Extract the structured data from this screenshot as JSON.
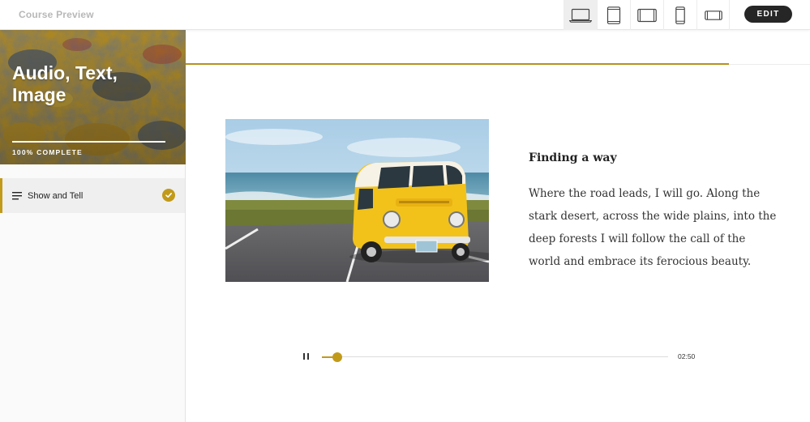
{
  "app": {
    "title": "Course Preview"
  },
  "toolbar": {
    "devices": [
      {
        "icon": "laptop-icon",
        "active": true
      },
      {
        "icon": "tablet-portrait-icon",
        "active": false
      },
      {
        "icon": "tablet-landscape-icon",
        "active": false
      },
      {
        "icon": "phone-portrait-icon",
        "active": false
      },
      {
        "icon": "phone-landscape-icon",
        "active": false
      }
    ],
    "edit_label": "EDIT"
  },
  "sidebar": {
    "course_title": "Audio, Text, Image",
    "progress_percent": 100,
    "progress_label": "100% COMPLETE",
    "lessons": [
      {
        "label": "Show and Tell",
        "completed": true
      }
    ]
  },
  "lesson": {
    "progress_percent": 87,
    "heading": "Finding a way",
    "body": "Where the road leads, I will go. Along the stark desert, across the wide plains, into the deep forests I will follow the call of the world and embrace its ferocious beauty."
  },
  "audio": {
    "state": "playing",
    "position_fraction": 0.045,
    "duration": "02:50"
  },
  "colors": {
    "accent": "#c29a1a",
    "edit_button": "#262626"
  }
}
